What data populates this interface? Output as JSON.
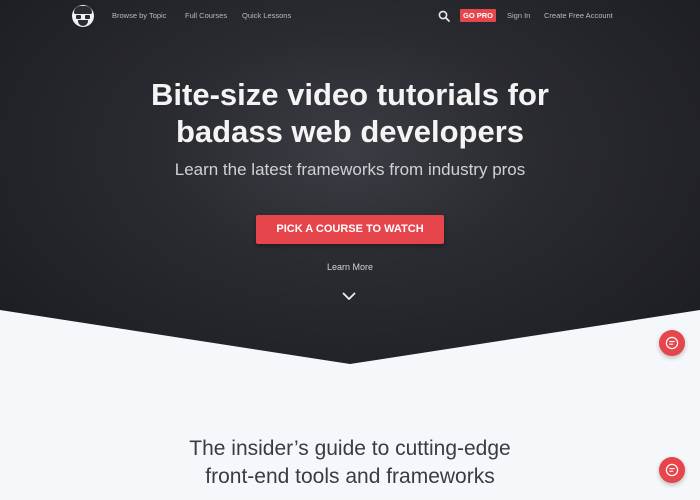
{
  "nav": {
    "links": [
      "Browse by Topic",
      "Full Courses",
      "Quick Lessons"
    ],
    "go_pro": "GO PRO",
    "sign_in": "Sign In",
    "create_account": "Create Free Account",
    "icons": {
      "logo": "egghead-logo",
      "search": "search-icon"
    }
  },
  "hero": {
    "title_line1": "Bite-size video tutorials for",
    "title_line2": "badass web developers",
    "subtitle": "Learn the latest frameworks from industry pros",
    "cta": "PICK A COURSE TO WATCH",
    "learn_more": "Learn More"
  },
  "section": {
    "title_line1": "The insider’s guide to cutting-edge",
    "title_line2": "front-end tools and frameworks"
  },
  "colors": {
    "accent": "#e6454b",
    "hero_bg": "#2a2b31",
    "page_bg": "#f5f8fb"
  }
}
